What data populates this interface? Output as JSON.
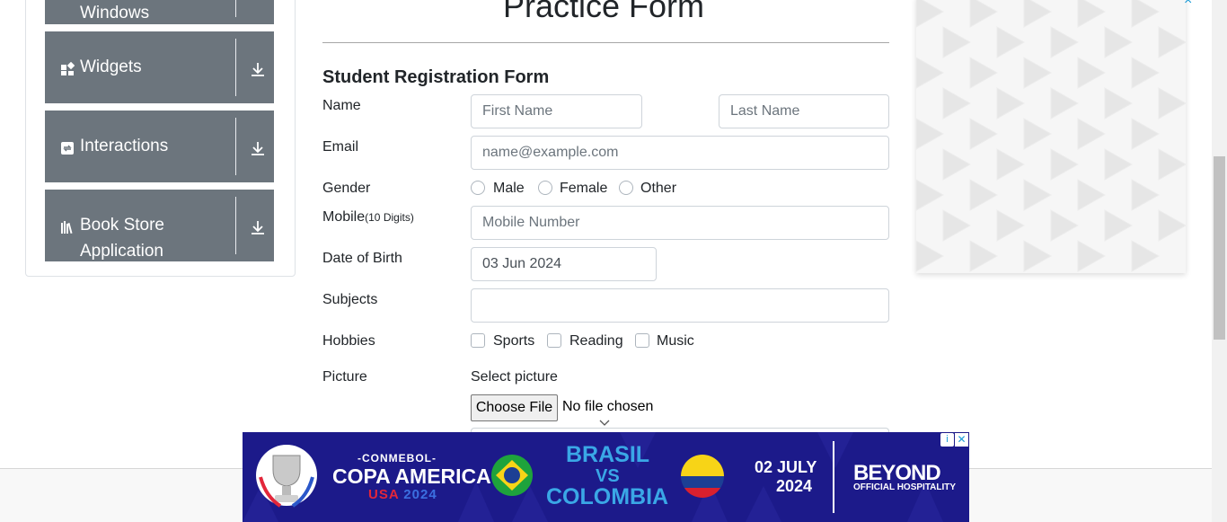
{
  "sidebar": {
    "groups": [
      {
        "label": "Windows",
        "icon": "window-icon"
      },
      {
        "label": "Widgets",
        "icon": "widgets-icon"
      },
      {
        "label": "Interactions",
        "icon": "interactions-icon"
      },
      {
        "label": "Book Store",
        "label2": "Application",
        "icon": "book-store-icon"
      }
    ]
  },
  "form": {
    "title": "Practice Form",
    "subtitle": "Student Registration Form",
    "name_label": "Name",
    "first_name_placeholder": "First Name",
    "last_name_placeholder": "Last Name",
    "email_label": "Email",
    "email_placeholder": "name@example.com",
    "gender_label": "Gender",
    "gender_options": [
      "Male",
      "Female",
      "Other"
    ],
    "mobile_label": "Mobile",
    "mobile_hint": "(10 Digits)",
    "mobile_placeholder": "Mobile Number",
    "dob_label": "Date of Birth",
    "dob_value": "03 Jun 2024",
    "subjects_label": "Subjects",
    "subjects_value": "",
    "hobbies_label": "Hobbies",
    "hobbies_options": [
      "Sports",
      "Reading",
      "Music"
    ],
    "picture_label": "Picture",
    "select_picture_label": "Select picture",
    "choose_file_label": "Choose File",
    "file_status": "No file chosen"
  },
  "ads": {
    "side_close": "×",
    "banner": {
      "conmebol": "-CONMEBOL-",
      "copa": "COPA AMERICA",
      "usa": "USA",
      "year": "2024",
      "team1": "BRASIL",
      "vs": "VS",
      "team2": "COLOMBIA",
      "date1": "02 JULY",
      "date2": "2024",
      "brand": "BEYOND",
      "brand_sub": "OFFICIAL HOSPITALITY",
      "adchoice": "i",
      "close": "✕"
    }
  },
  "colors": {
    "sidebar_header": "#6c757d",
    "banner_bg": "#1c1a8a",
    "accent_blue": "#3aa7e6"
  }
}
